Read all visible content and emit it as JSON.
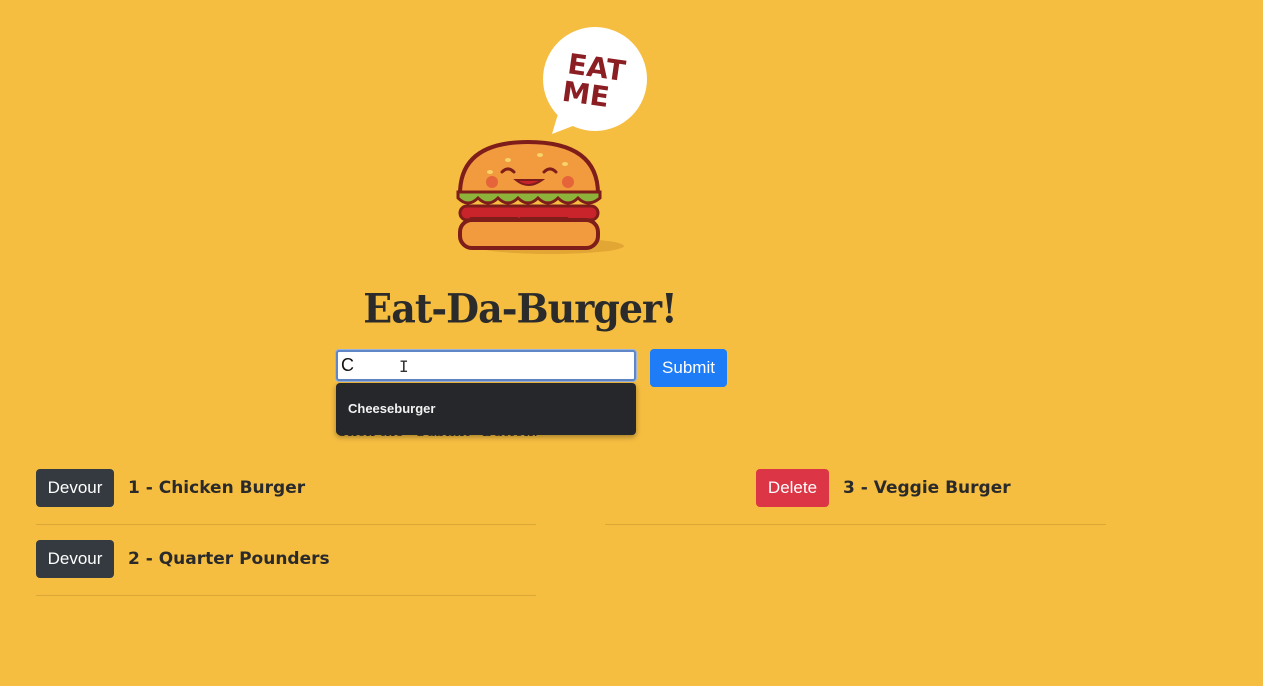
{
  "header": {
    "title": "Eat-Da-Burger!",
    "logo_speech_text_line1": "EAT",
    "logo_speech_text_line2": "ME"
  },
  "form": {
    "input_value": "C",
    "submit_label": "Submit",
    "helper_text": "Click the \"Submit\" Button."
  },
  "autocomplete": {
    "items": [
      "Cheeseburger"
    ]
  },
  "uneaten": [
    {
      "button": "Devour",
      "label": "1 - Chicken Burger"
    },
    {
      "button": "Devour",
      "label": "2 - Quarter Pounders"
    }
  ],
  "devoured": [
    {
      "button": "Delete",
      "label": "3 - Veggie Burger"
    }
  ],
  "colors": {
    "background": "#F6BE41",
    "submit": "#1E7CF6",
    "devour": "#343A40",
    "delete": "#DC3545"
  }
}
